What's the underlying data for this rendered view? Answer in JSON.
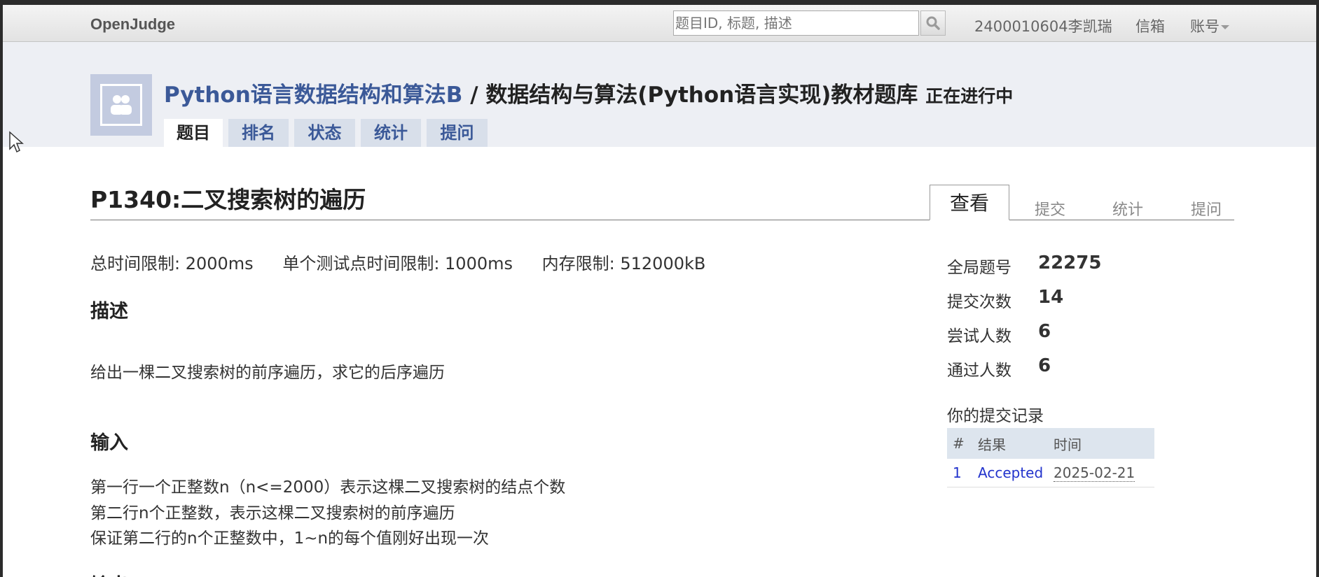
{
  "topbar": {
    "brand": "OpenJudge",
    "search_placeholder": "题目ID, 标题, 描述",
    "user": "2400010604李凯瑞",
    "mail": "信箱",
    "account": "账号"
  },
  "contest": {
    "course": "Python语言数据结构和算法B",
    "separator": "/",
    "name": "数据结构与算法(Python语言实现)教材题库",
    "status": "正在进行中",
    "tabs": [
      "题目",
      "排名",
      "状态",
      "统计",
      "提问"
    ],
    "active_tab": "题目"
  },
  "problem": {
    "title": "P1340:二叉搜索树的遍历",
    "side_tabs": [
      "查看",
      "提交",
      "统计",
      "提问"
    ],
    "limits": [
      "总时间限制: 2000ms",
      "单个测试点时间限制: 1000ms",
      "内存限制: 512000kB"
    ],
    "description_heading": "描述",
    "description": "给出一棵二叉搜索树的前序遍历，求它的后序遍历",
    "input_heading": "输入",
    "input_lines": [
      "第一行一个正整数n（n<=2000）表示这棵二叉搜索树的结点个数",
      "第二行n个正整数，表示这棵二叉搜索树的前序遍历",
      "保证第二行的n个正整数中，1~n的每个值刚好出现一次"
    ],
    "output_heading_partial": "输出"
  },
  "stats": {
    "items": [
      {
        "label": "全局题号",
        "value": "22275"
      },
      {
        "label": "提交次数",
        "value": "14"
      },
      {
        "label": "尝试人数",
        "value": "6"
      },
      {
        "label": "通过人数",
        "value": "6"
      }
    ]
  },
  "records": {
    "title": "你的提交记录",
    "headers": [
      "#",
      "结果",
      "时间"
    ],
    "rows": [
      {
        "num": "1",
        "result": "Accepted",
        "time": "2025-02-21"
      }
    ]
  },
  "colors": {
    "link_blue": "#3b5998",
    "tab_bg": "#d8dfea",
    "header_bg": "#edeff4",
    "accepted": "#2233cc"
  }
}
